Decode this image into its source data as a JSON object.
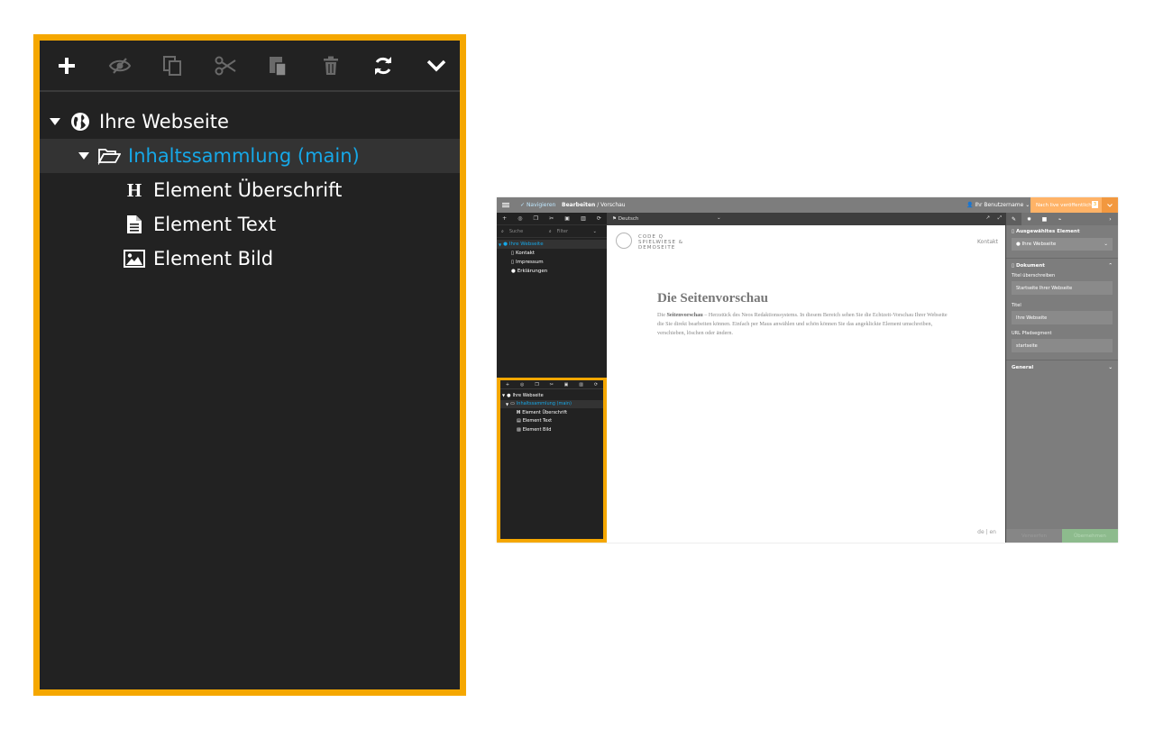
{
  "zoom": {
    "toolbar_icons": [
      "plus-icon",
      "eye-slash-icon",
      "copy-icon",
      "cut-icon",
      "paste-icon",
      "trash-icon",
      "refresh-icon",
      "chevron-down-icon"
    ],
    "tree": {
      "root": "Ihre Webseite",
      "collection": "Inhaltssammlung (main)",
      "items": [
        "Element Überschrift",
        "Element Text",
        "Element Bild"
      ]
    }
  },
  "screenshot": {
    "topbar": {
      "publish_label": "Nach live veröffentlichen",
      "publish_count": "3",
      "breadcrumb_link": "Bearbeiten",
      "breadcrumb_sep": " / ",
      "breadcrumb_current": "Vorschau",
      "nav_link": "Navigieren",
      "user": "Ihr Benutzername"
    },
    "left": {
      "search_placeholder": "Suche",
      "filter_label": "Filter",
      "pages": {
        "root": "Ihre Webseite",
        "children": [
          "Kontakt",
          "Impressum",
          "Erklärungen"
        ]
      },
      "content_tree": {
        "root": "Ihre Webseite",
        "collection": "Inhaltssammlung (main)",
        "items": [
          "Element Überschrift",
          "Element Text",
          "Element Bild"
        ]
      }
    },
    "content_bar": {
      "language": "Deutsch"
    },
    "page": {
      "logo_line1": "CODE Q",
      "logo_line2": "SPIELWIESE &",
      "logo_line3": "DEMOSEITE",
      "nav_link": "Kontakt",
      "heading": "Die Seitenvorschau",
      "para_prefix": "Die ",
      "para_bold": "Seitenvorschau",
      "para_rest": " – Herzstück des Neos Redaktionssystems. In diesem Bereich sehen Sie die Echtzeit-Vorschau Ihrer Webseite die Sie direkt bearbeiten können. Einfach per Maus anwählen und schön können Sie das angeklickte Element umschreiben, verschieben, löschen oder ändern.",
      "lang_switch": "de | en"
    },
    "inspector": {
      "selected_label": "Ausgewähltes Element",
      "selected_value": "Ihre Webseite",
      "section_document": "Dokument",
      "field_title_override_label": "Titel überschreiben",
      "field_title_override_value": "Startseite Ihrer Webseite",
      "field_title_label": "Titel",
      "field_title_value": "Ihre Webseite",
      "field_url_label": "URL Pfadsegment",
      "field_url_value": "startseite",
      "section_general": "General",
      "discard": "Verwerfen",
      "apply": "Übernehmen"
    }
  },
  "colors": {
    "highlight_border": "#f5a700",
    "active_link": "#16a8e8",
    "publish": "#ffb367"
  }
}
